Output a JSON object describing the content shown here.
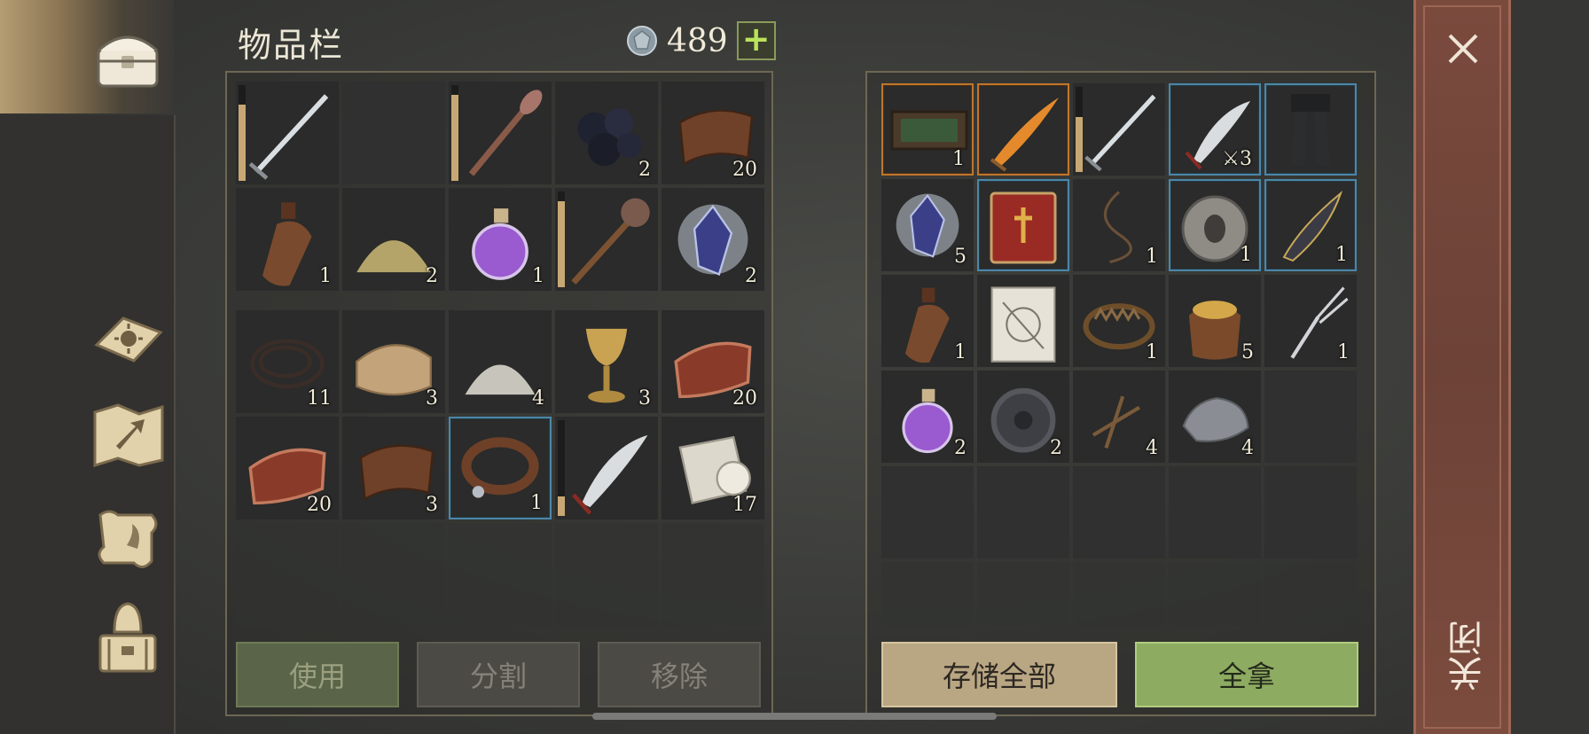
{
  "inventory": {
    "title": "物品栏",
    "currency": "489",
    "add_label": "+"
  },
  "left_top_slots": [
    {
      "icon": "sword-icon",
      "count": "",
      "durability": 0.8
    },
    {
      "icon": "",
      "count": ""
    },
    {
      "icon": "spiked-club-icon",
      "count": "",
      "durability": 0.9
    },
    {
      "icon": "coal-icon",
      "count": "2"
    },
    {
      "icon": "leather-icon",
      "count": "20"
    },
    {
      "icon": "bottle-icon",
      "count": "1"
    },
    {
      "icon": "sand-pile-icon",
      "count": "2"
    },
    {
      "icon": "potion-icon",
      "count": "1"
    },
    {
      "icon": "mace-icon",
      "count": "",
      "durability": 0.9
    },
    {
      "icon": "crystal-icon",
      "count": "2"
    }
  ],
  "left_bottom_slots": [
    {
      "icon": "rope-coil-icon",
      "count": "11"
    },
    {
      "icon": "cloth-icon",
      "count": "3"
    },
    {
      "icon": "salt-pile-icon",
      "count": "4"
    },
    {
      "icon": "goblet-icon",
      "count": "3"
    },
    {
      "icon": "raw-meat-icon",
      "count": "20"
    },
    {
      "icon": "raw-meat-icon",
      "count": "20"
    },
    {
      "icon": "leather-icon",
      "count": "3"
    },
    {
      "icon": "collar-icon",
      "count": "1",
      "quality": "blue"
    },
    {
      "icon": "scimitar-icon",
      "count": "",
      "durability": 0.2
    },
    {
      "icon": "bandage-roll-icon",
      "count": "17"
    }
  ],
  "right_slots": [
    {
      "icon": "tray-icon",
      "count": "1",
      "quality": "orange"
    },
    {
      "icon": "flame-sword-icon",
      "count": "",
      "quality": "orange"
    },
    {
      "icon": "sword-icon",
      "count": "",
      "durability": 0.65
    },
    {
      "icon": "scimitar-icon",
      "count": "3",
      "quality": "blue",
      "upgrade": "⚔"
    },
    {
      "icon": "greaves-icon",
      "count": "",
      "quality": "blue"
    },
    {
      "icon": "crystal-icon",
      "count": "5"
    },
    {
      "icon": "book-icon",
      "count": "",
      "quality": "blue"
    },
    {
      "icon": "rope-icon",
      "count": "1"
    },
    {
      "icon": "whetstone-icon",
      "count": "1",
      "quality": "blue"
    },
    {
      "icon": "ornate-hilt-icon",
      "count": "1",
      "quality": "blue"
    },
    {
      "icon": "bottle-icon",
      "count": "1"
    },
    {
      "icon": "blueprint-icon",
      "count": ""
    },
    {
      "icon": "bear-trap-icon",
      "count": "1"
    },
    {
      "icon": "grain-sack-icon",
      "count": "5"
    },
    {
      "icon": "fork-icon",
      "count": "1"
    },
    {
      "icon": "potion-icon",
      "count": "2"
    },
    {
      "icon": "gear-icon",
      "count": "2"
    },
    {
      "icon": "nails-icon",
      "count": "4"
    },
    {
      "icon": "stone-icon",
      "count": "4"
    },
    {
      "icon": "",
      "count": ""
    }
  ],
  "buttons": {
    "use": "使用",
    "split": "分割",
    "remove": "移除",
    "store_all": "存储全部",
    "take_all": "全拿"
  },
  "close": {
    "label": "关闭"
  },
  "colors": {
    "quality_blue": "#4b87a8",
    "quality_orange": "#c0752c",
    "take_all_green": "#8eab62",
    "close_panel": "#7a4a3d"
  }
}
